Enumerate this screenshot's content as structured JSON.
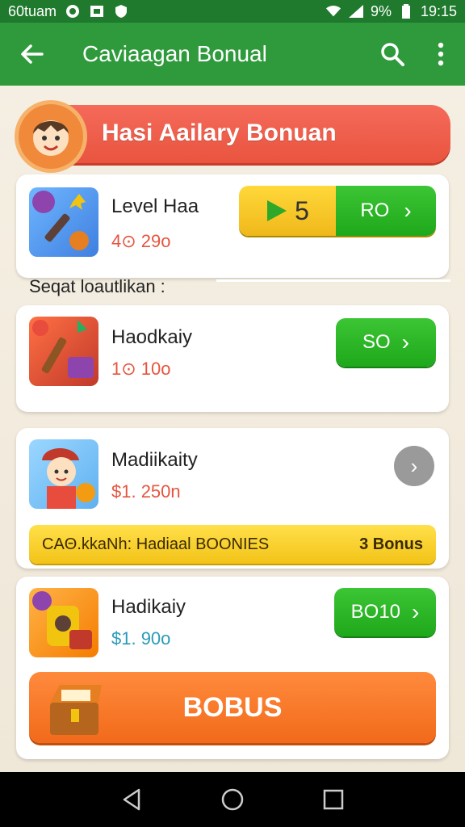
{
  "status_bar": {
    "left_text": "60tuam",
    "battery": "9%",
    "time": "19:15"
  },
  "app_bar": {
    "title": "Caviaagan Bonual",
    "icons": [
      "back-arrow-icon",
      "search-icon",
      "more-vert-icon"
    ]
  },
  "banner": {
    "title": "Hasi Aailary Bonuan"
  },
  "cards": [
    {
      "title": "Level Haa",
      "sub_value": "4⊙ 29o",
      "level_number": "5",
      "button_label": "RO"
    },
    {
      "title": "Haodkaiy",
      "sub_value": "1⊙ 10o",
      "button_label": "SO"
    },
    {
      "title": "Madiikaity",
      "sub_value": "$1. 250n",
      "strip_text": "CAΘ.kkaNh: Hadiaal BOONIES",
      "strip_right": "3 Bonus"
    },
    {
      "title": "Hadikaiy",
      "sub_value": "$1. 90o",
      "button_label": "BO10",
      "big_button_label": "BOBUS"
    }
  ],
  "section_label": "Seqat loautlikan :",
  "colors": {
    "status_bar": "#1f7a2e",
    "app_bar": "#2e9a3b",
    "banner": "#e9543f",
    "green_button": "#1ea81b",
    "yellow": "#f0b81a",
    "orange": "#f26a1b"
  }
}
